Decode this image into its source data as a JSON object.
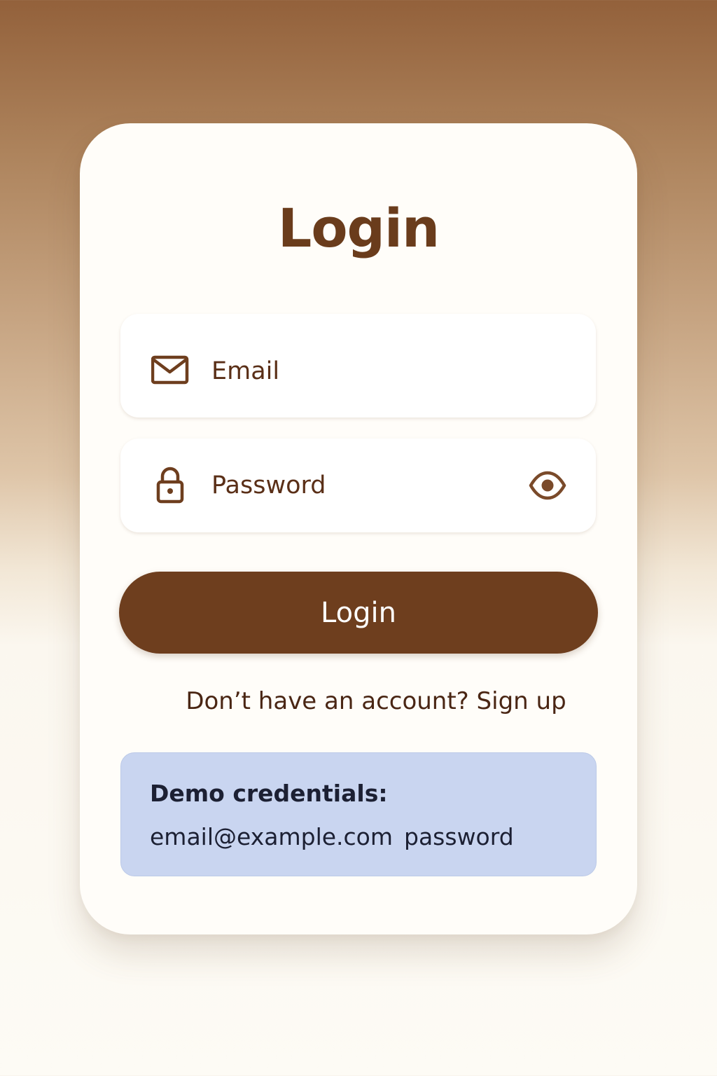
{
  "page": {
    "title": "Login"
  },
  "form": {
    "email": {
      "placeholder": "Email",
      "value": "",
      "icon": "mail-icon"
    },
    "password": {
      "placeholder": "Password",
      "value": "",
      "icon": "lock-icon",
      "toggle_icon": "eye-icon"
    },
    "login_button_label": "Login"
  },
  "signup": {
    "prompt": "Don’t have an account?",
    "link_label": "Sign up"
  },
  "demo": {
    "title": "Demo credentials:",
    "email": "email@example.com",
    "password": "password"
  },
  "colors": {
    "accent": "#6e3e1e",
    "title": "#6a3c1c",
    "demo_background": "#c9d5f0"
  }
}
